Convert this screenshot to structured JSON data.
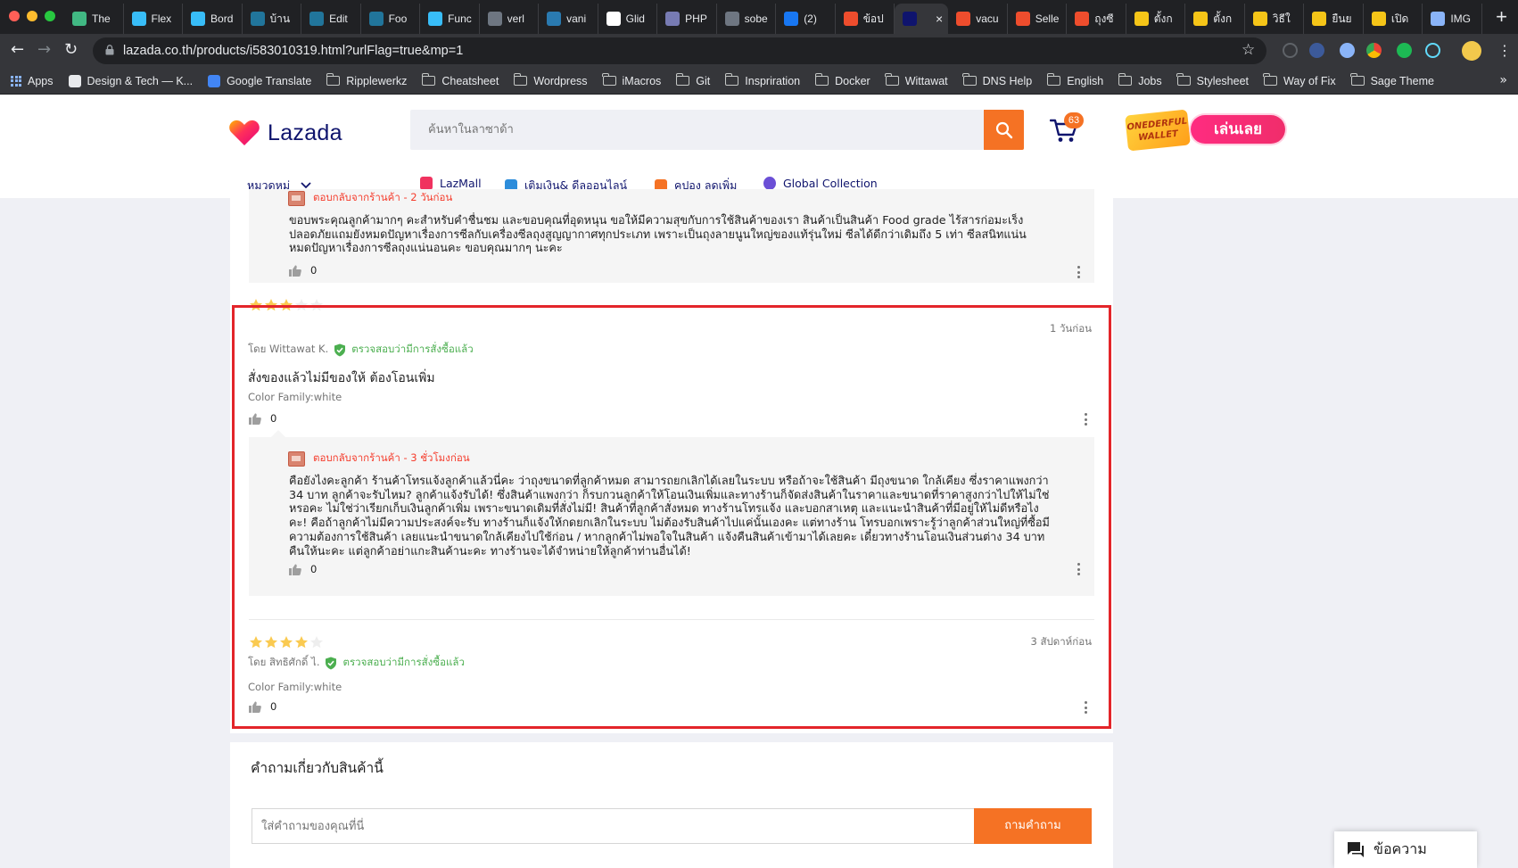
{
  "browser": {
    "tabs": [
      {
        "label": "The",
        "icon": "vue-icon",
        "color": "#41b883"
      },
      {
        "label": "Flex",
        "icon": "tailwind-icon",
        "color": "#38bdf8"
      },
      {
        "label": "Bord",
        "icon": "tailwind-icon",
        "color": "#38bdf8"
      },
      {
        "label": "บ้าน",
        "icon": "wordpress-icon",
        "color": "#21759b"
      },
      {
        "label": "Edit",
        "icon": "wordpress-icon",
        "color": "#21759b"
      },
      {
        "label": "Foo",
        "icon": "wordpress-icon",
        "color": "#21759b"
      },
      {
        "label": "Func",
        "icon": "tailwind-icon",
        "color": "#38bdf8"
      },
      {
        "label": "verl",
        "icon": "github-icon",
        "color": "#6e7681"
      },
      {
        "label": "vani",
        "icon": "vanilla-icon",
        "color": "#2a7ab0"
      },
      {
        "label": "Glid",
        "icon": "glide-icon",
        "color": "#ffffff"
      },
      {
        "label": "PHP",
        "icon": "php-icon",
        "color": "#777bb3"
      },
      {
        "label": "sobe",
        "icon": "github-icon",
        "color": "#6e7681"
      },
      {
        "label": "(2) ",
        "icon": "facebook-icon",
        "color": "#1877f2"
      },
      {
        "label": "ข้อป",
        "icon": "shopee-icon",
        "color": "#ee4d2d"
      },
      {
        "label": "",
        "icon": "lazada-icon",
        "color": "#0f146d",
        "active": true,
        "close": "×"
      },
      {
        "label": "vacu",
        "icon": "shopee-icon",
        "color": "#ee4d2d"
      },
      {
        "label": "Selle",
        "icon": "shopee-icon",
        "color": "#ee4d2d"
      },
      {
        "label": "ถุงซี",
        "icon": "shopee-icon",
        "color": "#ee4d2d"
      },
      {
        "label": "ตั้งก",
        "icon": "pacman-icon",
        "color": "#f5c518"
      },
      {
        "label": "ตั้งก",
        "icon": "pacman-icon",
        "color": "#f5c518"
      },
      {
        "label": "วิธีใ",
        "icon": "pacman-icon",
        "color": "#f5c518"
      },
      {
        "label": "ยืนย",
        "icon": "pacman-icon",
        "color": "#f5c518"
      },
      {
        "label": "เปิด",
        "icon": "pacman-icon",
        "color": "#f5c518"
      },
      {
        "label": "IMG",
        "icon": "info-icon",
        "color": "#8ab4f8"
      }
    ],
    "new_tab": "+",
    "url": "lazada.co.th/products/i583010319.html?urlFlag=true&mp=1",
    "bookmarks": [
      {
        "label": "Apps",
        "icon": "apps-grid-icon"
      },
      {
        "label": "Design & Tech — K...",
        "icon": "kinfolk-icon"
      },
      {
        "label": "Google Translate",
        "icon": "google-translate-icon"
      },
      {
        "label": "Ripplewerkz",
        "icon": "folder-icon"
      },
      {
        "label": "Cheatsheet",
        "icon": "folder-icon"
      },
      {
        "label": "Wordpress",
        "icon": "folder-icon"
      },
      {
        "label": "iMacros",
        "icon": "folder-icon"
      },
      {
        "label": "Git",
        "icon": "folder-icon"
      },
      {
        "label": "Inspriration",
        "icon": "folder-icon"
      },
      {
        "label": "Docker",
        "icon": "folder-icon"
      },
      {
        "label": "Wittawat",
        "icon": "folder-icon"
      },
      {
        "label": "DNS Help",
        "icon": "folder-icon"
      },
      {
        "label": "English",
        "icon": "folder-icon"
      },
      {
        "label": "Jobs",
        "icon": "folder-icon"
      },
      {
        "label": "Stylesheet",
        "icon": "folder-icon"
      },
      {
        "label": "Way of Fix",
        "icon": "folder-icon"
      },
      {
        "label": "Sage Theme",
        "icon": "folder-icon"
      }
    ],
    "bookmarks_more": "»"
  },
  "header": {
    "logo_text": "Lazada",
    "search_placeholder": "ค้นหาในลาซาด้า",
    "cart_count": "63",
    "promo_wallet_text": "ONEDERFUL WALLET",
    "promo_button": "เล่นเลย",
    "category_menu": "หมวดหมู่",
    "nav": [
      {
        "label": "LazMall",
        "icon": "lazmall-icon",
        "color": "#f0325f"
      },
      {
        "label": "เติมเงิน& ดีลออนไลน์",
        "icon": "topup-icon",
        "color": "#2d8ddb"
      },
      {
        "label": "คูปอง ลดเพิ่ม",
        "icon": "coupon-icon",
        "color": "#f57224"
      },
      {
        "label": "Global Collection",
        "icon": "global-collection-icon",
        "color": "#6b4fd6"
      }
    ]
  },
  "reviews": {
    "prev_reply": {
      "head": "ตอบกลับจากร้านค้า - 2 วันก่อน",
      "lines": [
        "ขอบพระคุณลูกค้ามากๆ คะสำหรับคำชื่นชม และขอบคุณที่อุดหนุน ขอให้มีความสุขกับการใช้สินค้าของเรา สินค้าเป็นสินค้า Food grade ไร้สารก่อมะเร็ง",
        "ปลอดภัยแถมยังหมดปัญหาเรื่องการซีลกับเครื่องซีลถุงสูญญากาศทุกประเภท เพราะเป็นถุงลายนูนใหญ่ของแท้รุ่นใหม่ ซีลได้ดีกว่าเดิมถึง 5 เท่า ซีลสนิทแน่น",
        "หมดปัญหาเรื่องการซีลถุงแน่นอนคะ ขอบคุณมากๆ นะคะ"
      ],
      "likes": "0"
    },
    "items": [
      {
        "rating": 3,
        "date": "1 วันก่อน",
        "author": "โดย Wittawat K.",
        "verified": "ตรวจสอบว่ามีการสั่งซื้อแล้ว",
        "text": "สั่งของแล้วไม่มีของให้ ต้องโอนเพิ่ม",
        "sku": "Color Family:white",
        "likes": "0",
        "reply": {
          "head": "ตอบกลับจากร้านค้า - 3 ชั่วโมงก่อน",
          "lines": [
            "คือยังไงคะลูกค้า ร้านค้าโทรแจ้งลูกค้าแล้วนี่คะ ว่าถุงขนาดที่ลูกค้าหมด สามารถยกเลิกได้เลยในระบบ หรือถ้าจะใช้สินค้า มีถุงขนาด ใกล้เคียง ซึ่งราคาแพงกว่า",
            "34 บาท ลูกค้าจะรับไหม? ลูกค้าแจ้งรับได้! ซึ่งสินค้าแพงกว่า ก็รบกวนลูกค้าให้โอนเงินเพิ่มและทางร้านก็จัดส่งสินค้าในราคาและขนาดที่ราคาสูงกว่าไปให้ไม่ใช่",
            "หรอคะ ไม่ใช่ว่าเรียกเก็บเงินลูกค้าเพิ่ม เพราะขนาดเดิมที่สั่งไม่มี! สินค้าที่ลูกค้าสั่งหมด ทางร้านโทรแจ้ง และบอกสาเหตุ และแนะนำสินค้าที่มีอยู่ให้ไม่ดีหรือไง",
            "คะ! คือถ้าลูกค้าไม่มีความประสงค์จะรับ ทางร้านก็แจ้งให้กดยกเลิกในระบบ ไม่ต้องรับสินค้าไปแค่นั้นเองคะ แต่ทางร้าน โทรบอกเพราะรู้ว่าลูกค้าส่วนใหญ่ที่ซื้อมี",
            "ความต้องการใช้สินค้า เลยแนะนำขนาดใกล้เคียงไปใช้ก่อน / หากลูกค้าไม่พอใจในสินค้า แจ้งคืนสินค้าเข้ามาได้เลยคะ เดี๋ยวทางร้านโอนเงินส่วนต่าง 34 บาท",
            "คืนให้นะคะ แต่ลูกค้าอย่าแกะสินค้านะคะ ทางร้านจะได้จำหน่ายให้ลูกค้าท่านอื่นได้!"
          ],
          "likes": "0"
        }
      },
      {
        "rating": 4,
        "date": "3 สัปดาห์ก่อน",
        "author": "โดย สิทธิศักดิ์ ไ.",
        "verified": "ตรวจสอบว่ามีการสั่งซื้อแล้ว",
        "sku": "Color Family:white",
        "likes": "0"
      }
    ]
  },
  "qa": {
    "title": "คำถามเกี่ยวกับสินค้านี้",
    "input_placeholder": "ใส่คำถามของคุณที่นี่",
    "ask_button": "ถามคำถาม"
  },
  "chat_widget": {
    "label": "ข้อความ"
  },
  "colors": {
    "accent": "#f57224",
    "highlight": "#e3252a",
    "verified": "#4caf50",
    "star": "#faca51"
  }
}
